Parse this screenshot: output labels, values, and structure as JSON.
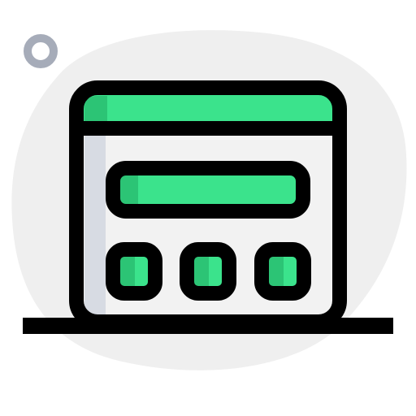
{
  "icon": {
    "name": "browser-window-calculator-icon",
    "style": "two-tone outlined illustration on soft blob background"
  },
  "colors": {
    "background": "#ffffff",
    "blob": "#efefef",
    "outline": "#000000",
    "accent_green": "#3be38c",
    "accent_green_dark": "#2cc475",
    "window_fill": "#f2f2f2",
    "window_shadow": "#d7dbe3",
    "ring": "#a6acb9"
  },
  "window": {
    "has_title_bar": true,
    "display_bar_count": 1,
    "button_count": 3
  }
}
